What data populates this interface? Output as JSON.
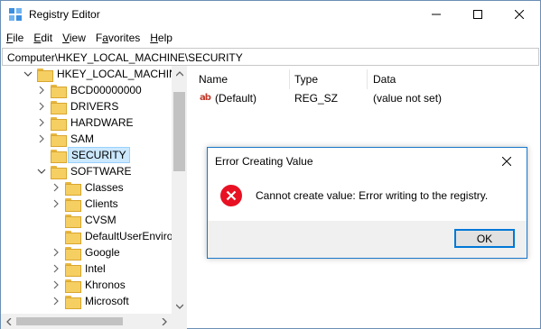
{
  "window": {
    "title": "Registry Editor",
    "icon": "registry-editor-icon"
  },
  "menu": [
    "File",
    "Edit",
    "View",
    "Favorites",
    "Help"
  ],
  "menu_access_keys": [
    "F",
    "E",
    "V",
    "a",
    "H"
  ],
  "address": "Computer\\HKEY_LOCAL_MACHINE\\SECURITY",
  "tree": {
    "root": "HKEY_LOCAL_MACHINE",
    "items": [
      {
        "label": "BCD00000000"
      },
      {
        "label": "DRIVERS"
      },
      {
        "label": "HARDWARE"
      },
      {
        "label": "SAM"
      },
      {
        "label": "SECURITY",
        "selected": true
      },
      {
        "label": "SOFTWARE",
        "expanded": true
      }
    ],
    "software_children": [
      {
        "label": "Classes",
        "chevron": true
      },
      {
        "label": "Clients",
        "chevron": true
      },
      {
        "label": "CVSM",
        "chevron": false
      },
      {
        "label": "DefaultUserEnvironment",
        "chevron": false
      },
      {
        "label": "Google",
        "chevron": true
      },
      {
        "label": "Intel",
        "chevron": true
      },
      {
        "label": "Khronos",
        "chevron": true
      },
      {
        "label": "Microsoft",
        "chevron": true
      }
    ]
  },
  "list": {
    "columns": [
      "Name",
      "Type",
      "Data"
    ],
    "rows": [
      {
        "name": "(Default)",
        "type": "REG_SZ",
        "data": "(value not set)",
        "icon": "string-value-icon",
        "icon_text": "ab"
      }
    ]
  },
  "dialog": {
    "title": "Error Creating Value",
    "message": "Cannot create value: Error writing to the registry.",
    "ok_label": "OK",
    "icon": "error-icon"
  },
  "colors": {
    "accent": "#0078d7",
    "selection": "#cce8ff",
    "folder": "#f6cf62",
    "error": "#e81123"
  }
}
